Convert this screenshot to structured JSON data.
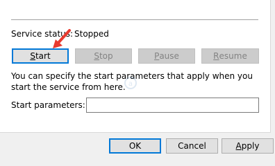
{
  "status": {
    "label": "Service status:",
    "value": "Stopped"
  },
  "controls": {
    "start": {
      "first": "S",
      "rest": "tart",
      "enabled": true
    },
    "stop": {
      "first": "S",
      "rest": "top",
      "enabled": false
    },
    "pause": {
      "first": "P",
      "rest": "ause",
      "enabled": false
    },
    "resume": {
      "first": "R",
      "rest": "esume",
      "enabled": false
    }
  },
  "description": "You can specify the start parameters that apply when you start the service from here.",
  "params": {
    "label": "Start parameters:",
    "value": ""
  },
  "footer": {
    "ok": "OK",
    "cancel": "Cancel",
    "apply_first": "A",
    "apply_rest": "pply"
  },
  "colors": {
    "arrow": "#e83a2f",
    "default_border": "#0078d7"
  }
}
